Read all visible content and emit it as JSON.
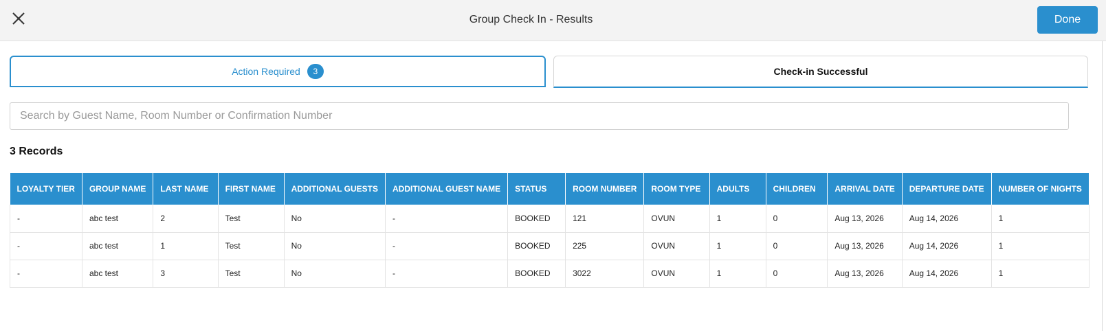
{
  "header": {
    "title": "Group Check In - Results",
    "done_label": "Done"
  },
  "tabs": [
    {
      "label": "Action Required",
      "badge": "3"
    },
    {
      "label": "Check-in Successful"
    }
  ],
  "search": {
    "placeholder": "Search by Guest Name, Room Number or Confirmation Number",
    "value": ""
  },
  "records_label": "3 Records",
  "table": {
    "columns": [
      "LOYALTY TIER",
      "GROUP NAME",
      "LAST NAME",
      "FIRST NAME",
      "ADDITIONAL GUESTS",
      "ADDITIONAL GUEST NAME",
      "STATUS",
      "ROOM NUMBER",
      "ROOM TYPE",
      "ADULTS",
      "CHILDREN",
      "ARRIVAL DATE",
      "DEPARTURE DATE",
      "NUMBER OF NIGHTS"
    ],
    "rows": [
      [
        "-",
        "abc test",
        "2",
        "Test",
        "No",
        "-",
        "BOOKED",
        "121",
        "OVUN",
        "1",
        "0",
        "Aug 13, 2026",
        "Aug 14, 2026",
        "1"
      ],
      [
        "-",
        "abc test",
        "1",
        "Test",
        "No",
        "-",
        "BOOKED",
        "225",
        "OVUN",
        "1",
        "0",
        "Aug 13, 2026",
        "Aug 14, 2026",
        "1"
      ],
      [
        "-",
        "abc test",
        "3",
        "Test",
        "No",
        "-",
        "BOOKED",
        "3022",
        "OVUN",
        "1",
        "0",
        "Aug 13, 2026",
        "Aug 14, 2026",
        "1"
      ]
    ]
  },
  "colors": {
    "accent": "#2a8fce",
    "header_bg": "#f3f3f3"
  },
  "icons": {
    "close": "close-icon"
  }
}
